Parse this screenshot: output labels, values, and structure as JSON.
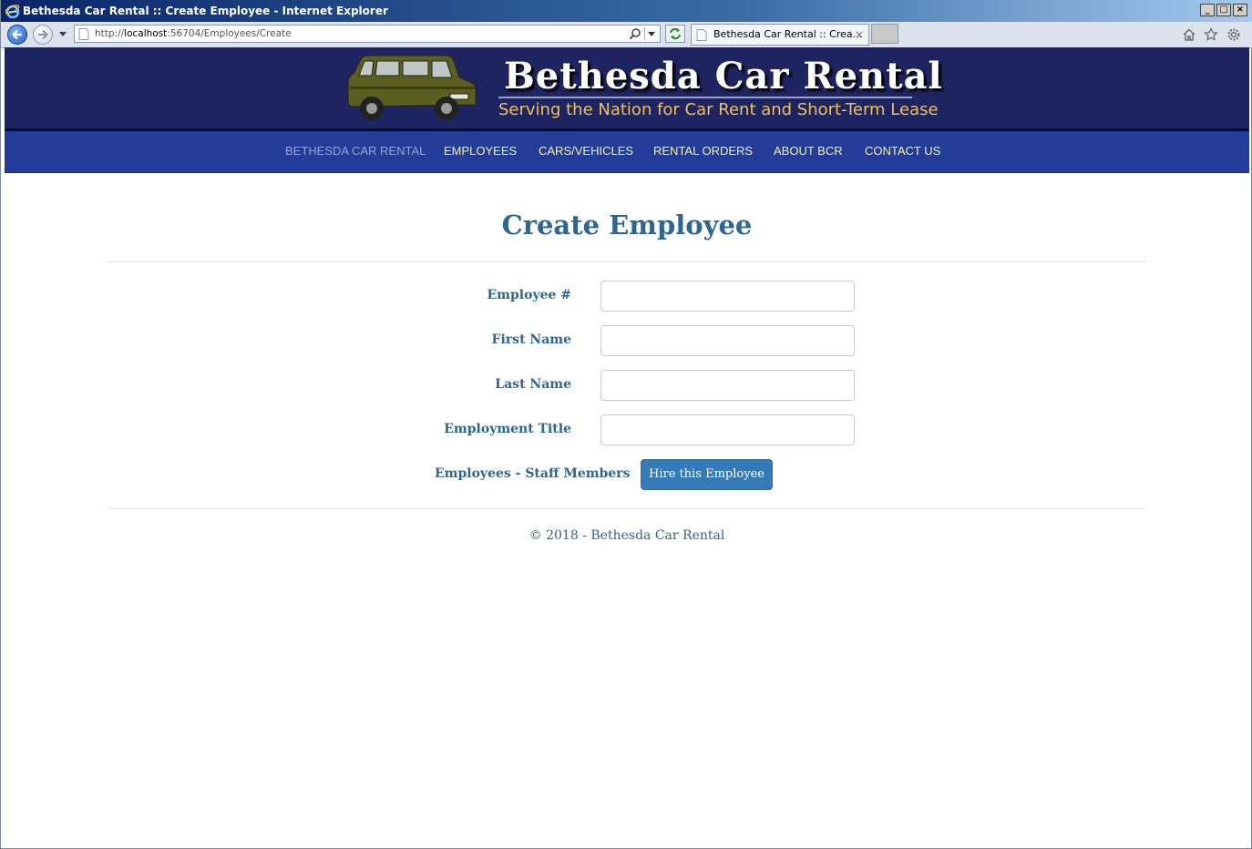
{
  "browser": {
    "window_title": "Bethesda Car Rental :: Create Employee - Internet Explorer",
    "url_prefix": "http://",
    "url_host": "localhost",
    "url_rest": ":56704/Employees/Create",
    "tab_label": "Bethesda Car Rental :: Crea...",
    "tab_close": "×",
    "min_glyph": "_",
    "max_glyph": "□",
    "close_glyph": "×"
  },
  "header": {
    "brand": "Bethesda Car Rental",
    "tagline": "Serving the Nation for Car Rent and Short-Term Lease"
  },
  "nav": {
    "items": [
      {
        "label": "BETHESDA CAR RENTAL"
      },
      {
        "label": "EMPLOYEES"
      },
      {
        "label": "CARS/VEHICLES"
      },
      {
        "label": "RENTAL ORDERS"
      },
      {
        "label": "ABOUT BCR"
      },
      {
        "label": "CONTACT US"
      }
    ]
  },
  "page": {
    "title": "Create Employee"
  },
  "form": {
    "fields": [
      {
        "label": "Employee #",
        "value": ""
      },
      {
        "label": "First Name",
        "value": ""
      },
      {
        "label": "Last Name",
        "value": ""
      },
      {
        "label": "Employment Title",
        "value": ""
      }
    ],
    "link_label": "Employees - Staff Members",
    "submit_label": "Hire this Employee"
  },
  "footer": {
    "text": "© 2018 - Bethesda Car Rental"
  },
  "colors": {
    "header_bg": "#1e2460",
    "nav_bg": "#233c9a",
    "nav_text": "#f7f0a0",
    "heading": "#2e6592",
    "button": "#337ab7"
  }
}
